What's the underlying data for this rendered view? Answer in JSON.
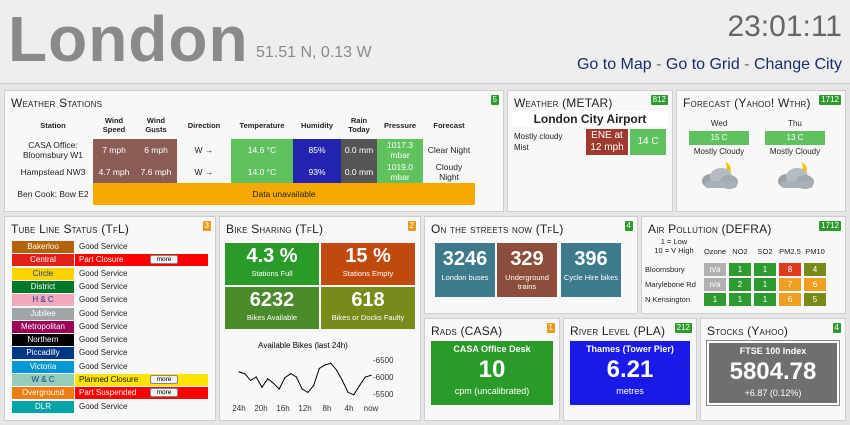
{
  "header": {
    "city": "London",
    "coords": "51.51 N, 0.13 W",
    "clock": "23:01:11",
    "links": [
      "Go to Map",
      "Go to Grid",
      "Change City"
    ],
    "separator": "-"
  },
  "weather_stations": {
    "title": "Weather Stations",
    "badge": "5",
    "columns": [
      "Station",
      "Wind Speed",
      "Wind Gusts",
      "Direction",
      "Temperature",
      "Humidity",
      "Rain Today",
      "Pressure",
      "Forecast"
    ],
    "rows": [
      {
        "station": "CASA Office: Bloomsbury W1",
        "wind": "7 mph",
        "gusts": "6 mph",
        "direction": "W →",
        "temp": "14.6 °C",
        "humidity": "85%",
        "rain": "0.0 mm",
        "pressure": "1017.3 mbar",
        "forecast": "Clear Night"
      },
      {
        "station": "Hampstead NW3",
        "wind": "4.7 mph",
        "gusts": "7.6 mph",
        "direction": "W →",
        "temp": "14.0 °C",
        "humidity": "93%",
        "rain": "0.0 mm",
        "pressure": "1019.0 mbar",
        "forecast": "Cloudy Night"
      }
    ],
    "unavailable_station": "Ben Cook: Bow E2",
    "unavailable_text": "Data unavailable",
    "colors": {
      "wind": "#8b5b55",
      "temp": "#5fc25f",
      "humidity": "#2323b0",
      "rain": "#555555",
      "unavailable": "#f6a900"
    }
  },
  "metar": {
    "title": "Weather (METAR)",
    "badge": "812",
    "station": "London City Airport",
    "condition": "Mostly cloudy",
    "condition2": "Mist",
    "wind": "ENE at 12 mph",
    "temp": "14 C"
  },
  "forecast": {
    "title": "Forecast (Yahoo! Wthr)",
    "badge": "1712",
    "days": [
      {
        "day": "Wed",
        "temp": "15 C",
        "cond": "Mostly Cloudy",
        "icon": "cloud-night-icon"
      },
      {
        "day": "Thu",
        "temp": "13 C",
        "cond": "Mostly Cloudy",
        "icon": "cloud-night-icon"
      }
    ]
  },
  "tube": {
    "title": "Tube Line Status (TfL)",
    "badge": "3",
    "more_label": "more",
    "lines": [
      {
        "line": "Bakerloo",
        "status": "Good Service",
        "bg": "#b36305",
        "fg": "#ffffff",
        "kind": "good"
      },
      {
        "line": "Central",
        "status": "Part Closure",
        "bg": "#e32017",
        "fg": "#ffffff",
        "kind": "closure"
      },
      {
        "line": "Circle",
        "status": "Good Service",
        "bg": "#ffd300",
        "fg": "#113b92",
        "kind": "good"
      },
      {
        "line": "District",
        "status": "Good Service",
        "bg": "#00782a",
        "fg": "#ffffff",
        "kind": "good"
      },
      {
        "line": "H & C",
        "status": "Good Service",
        "bg": "#f3a9bb",
        "fg": "#113b92",
        "kind": "good"
      },
      {
        "line": "Jubilee",
        "status": "Good Service",
        "bg": "#a0a5a9",
        "fg": "#ffffff",
        "kind": "good"
      },
      {
        "line": "Metropolitan",
        "status": "Good Service",
        "bg": "#9b0056",
        "fg": "#ffffff",
        "kind": "good"
      },
      {
        "line": "Northern",
        "status": "Good Service",
        "bg": "#000000",
        "fg": "#ffffff",
        "kind": "good"
      },
      {
        "line": "Piccadilly",
        "status": "Good Service",
        "bg": "#003688",
        "fg": "#ffffff",
        "kind": "good"
      },
      {
        "line": "Victoria",
        "status": "Good Service",
        "bg": "#0098d4",
        "fg": "#ffffff",
        "kind": "good"
      },
      {
        "line": "W & C",
        "status": "Planned Closure",
        "bg": "#95cdba",
        "fg": "#113b92",
        "kind": "planned"
      },
      {
        "line": "Overground",
        "status": "Part Suspended",
        "bg": "#ee7c0e",
        "fg": "#ffffff",
        "kind": "closure"
      },
      {
        "line": "DLR",
        "status": "Good Service",
        "bg": "#00a4a7",
        "fg": "#ffffff",
        "kind": "good"
      }
    ]
  },
  "bikes": {
    "title": "Bike Sharing (TfL)",
    "badge": "2",
    "boxes": [
      {
        "value": "4.3 %",
        "label": "Stations Full",
        "color": "#2a9a2a"
      },
      {
        "value": "15 %",
        "label": "Stations Empty",
        "color": "#c04a0e"
      },
      {
        "value": "6232",
        "label": "Bikes Available",
        "color": "#4a8a2a"
      },
      {
        "value": "618",
        "label": "Bikes or Docks Faulty",
        "color": "#7a8a1a"
      }
    ],
    "chart_title": "Available Bikes (last 24h)"
  },
  "chart_data": {
    "type": "line",
    "title": "Available Bikes (last 24h)",
    "categories": [
      "24h",
      "20h",
      "16h",
      "12h",
      "8h",
      "4h",
      "now"
    ],
    "series": [
      {
        "values": [
          6150,
          6100,
          5900,
          6000,
          5700,
          5950,
          5820,
          5650,
          5980,
          6100,
          6000,
          5650,
          5550,
          5750,
          6250,
          6350,
          6400,
          6200,
          5900,
          5550,
          5480,
          5750,
          6000,
          6050
        ]
      }
    ],
    "y_ticks": [
      "-6500",
      "-6000",
      "-5500"
    ],
    "ylim": [
      5300,
      6700
    ],
    "grid": false
  },
  "streets": {
    "title": "On the streets now (TfL)",
    "badge": "4",
    "boxes": [
      {
        "value": "3246",
        "label": "London buses",
        "color": "#3d7a8c"
      },
      {
        "value": "329",
        "label": "Underground trains",
        "color": "#8c4e3a"
      },
      {
        "value": "396",
        "label": "Cycle Hire bikes",
        "color": "#3d7a8c"
      }
    ]
  },
  "air": {
    "title": "Air Pollution (DEFRA)",
    "badge": "1712",
    "key_line1": "1 = Low",
    "key_line2": "10 = V High",
    "headers": [
      "Ozone",
      "NO2",
      "SO2",
      "PM2.5",
      "PM10"
    ],
    "sites": [
      {
        "name": "Bloomsbury",
        "values": [
          "n/a",
          "1",
          "1",
          "8",
          "4"
        ]
      },
      {
        "name": "Marylebone Rd",
        "values": [
          "n/a",
          "2",
          "1",
          "7",
          "6"
        ]
      },
      {
        "name": "N Kensington",
        "values": [
          "1",
          "1",
          "1",
          "6",
          "5"
        ]
      }
    ],
    "colors": {
      "na": "#b0b0b0",
      "low": "#2f9a2f",
      "high": "#e03a1e",
      "med": "#f0a020",
      "olive": "#7a8a1a"
    }
  },
  "rads": {
    "title": "Rads (CASA)",
    "badge": "1",
    "header": "CASA Office Desk",
    "value": "10",
    "sub": "cpm (uncalibrated)"
  },
  "river": {
    "title": "River Level (PLA)",
    "badge": "212",
    "header": "Thames (Tower Pier)",
    "value": "6.21",
    "sub": "metres"
  },
  "stocks": {
    "title": "Stocks (Yahoo)",
    "badge": "4",
    "header": "FTSE 100 Index",
    "value": "5804.78",
    "sub": "+6.87 (0.12%)"
  }
}
